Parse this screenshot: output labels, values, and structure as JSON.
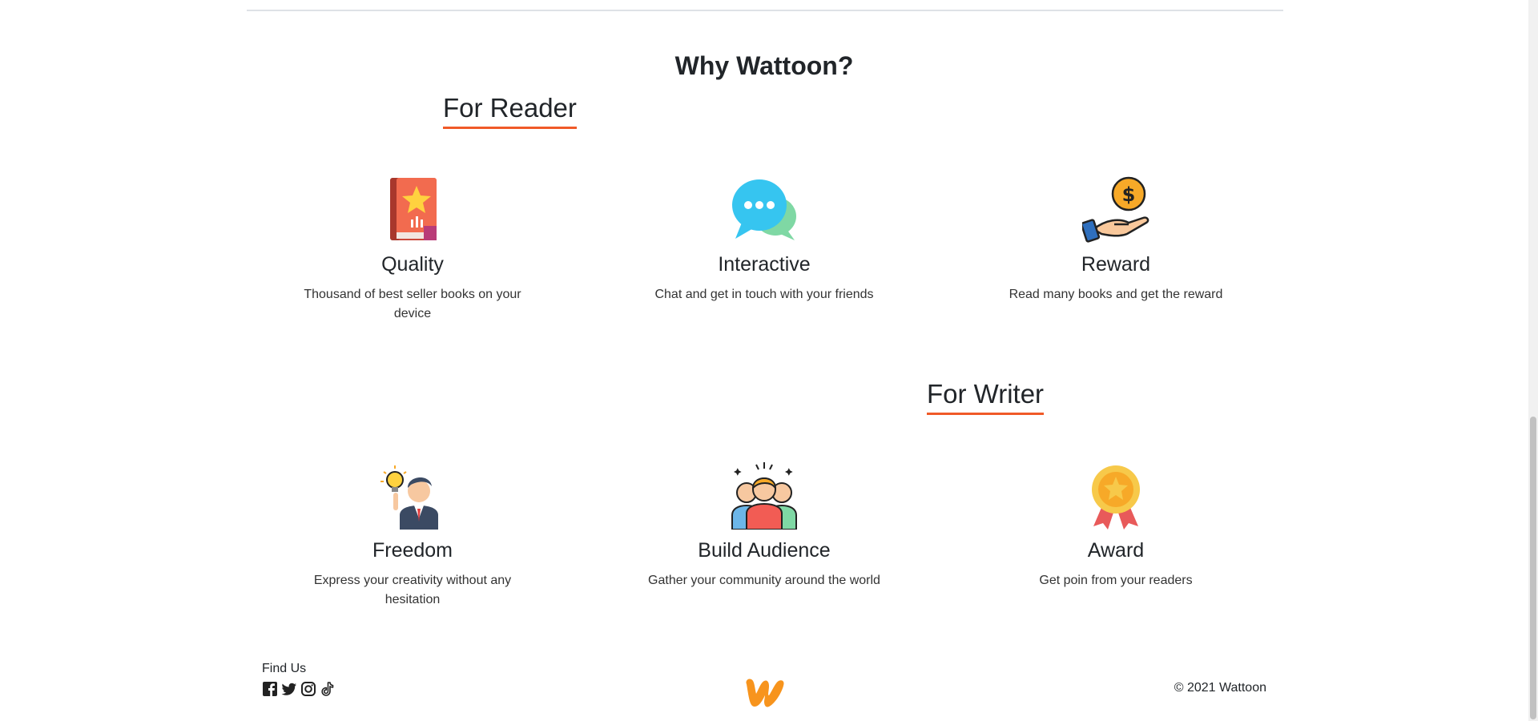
{
  "section": {
    "title": "Why Wattoon?"
  },
  "reader": {
    "heading": "For Reader",
    "features": [
      {
        "title": "Quality",
        "desc": "Thousand of best seller books on your device",
        "icon": "book-star-icon"
      },
      {
        "title": "Interactive",
        "desc": "Chat and get in touch with your friends",
        "icon": "chat-bubbles-icon"
      },
      {
        "title": "Reward",
        "desc": "Read many books and get the reward",
        "icon": "hand-coin-icon"
      }
    ]
  },
  "writer": {
    "heading": "For Writer",
    "features": [
      {
        "title": "Freedom",
        "desc": "Express your creativity without any hesitation",
        "icon": "businessman-idea-icon"
      },
      {
        "title": "Build Audience",
        "desc": "Gather your community around the world",
        "icon": "audience-group-icon"
      },
      {
        "title": "Award",
        "desc": "Get poin from your readers",
        "icon": "medal-icon"
      }
    ]
  },
  "footer": {
    "find_us": "Find Us",
    "social": [
      "facebook-icon",
      "twitter-icon",
      "instagram-icon",
      "tiktok-icon"
    ],
    "logo": "wattoon-logo",
    "copyright": "© 2021 Wattoon"
  },
  "colors": {
    "accent": "#f05a28",
    "logo": "#f7941d",
    "text": "#212529"
  }
}
